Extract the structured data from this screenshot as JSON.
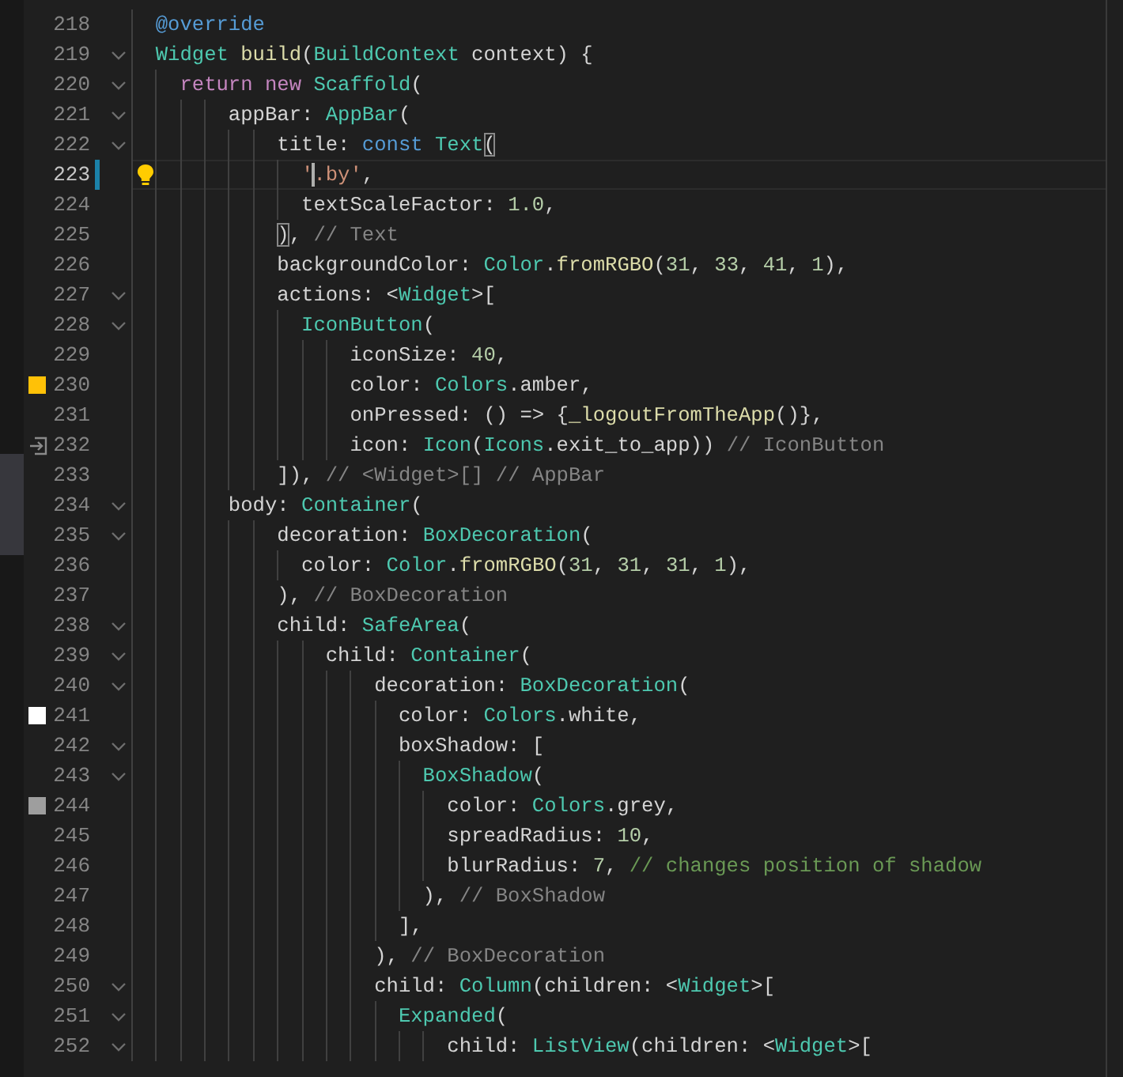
{
  "editor": {
    "lines": [
      {
        "number": "218",
        "foldable": false,
        "current": false,
        "tokens": [
          {
            "kind": "dec",
            "text": "  @override"
          }
        ]
      },
      {
        "number": "219",
        "foldable": true,
        "current": false,
        "tokens": [
          {
            "kind": "type",
            "text": "  Widget "
          },
          {
            "kind": "fn",
            "text": "build"
          },
          {
            "kind": "plain",
            "text": "("
          },
          {
            "kind": "type",
            "text": "BuildContext"
          },
          {
            "kind": "plain",
            "text": " context) {"
          }
        ]
      },
      {
        "number": "220",
        "foldable": true,
        "current": false,
        "tokens": [
          {
            "kind": "ctl",
            "text": "    return new "
          },
          {
            "kind": "type",
            "text": "Scaffold"
          },
          {
            "kind": "plain",
            "text": "("
          }
        ]
      },
      {
        "number": "221",
        "foldable": true,
        "current": false,
        "tokens": [
          {
            "kind": "plain",
            "text": "        appBar: "
          },
          {
            "kind": "type",
            "text": "AppBar"
          },
          {
            "kind": "plain",
            "text": "("
          }
        ]
      },
      {
        "number": "222",
        "foldable": true,
        "current": false,
        "tokens": [
          {
            "kind": "plain",
            "text": "            title: "
          },
          {
            "kind": "kw",
            "text": "const "
          },
          {
            "kind": "type",
            "text": "Text"
          },
          {
            "kind": "bracket",
            "text": "("
          }
        ]
      },
      {
        "number": "223",
        "foldable": false,
        "current": true,
        "modified": true,
        "lightbulb": true,
        "tokens": [
          {
            "kind": "str",
            "text": "              '"
          },
          {
            "kind": "cursor"
          },
          {
            "kind": "str",
            "text": ".by'"
          },
          {
            "kind": "plain",
            "text": ","
          }
        ]
      },
      {
        "number": "224",
        "foldable": false,
        "current": false,
        "tokens": [
          {
            "kind": "plain",
            "text": "              textScaleFactor: "
          },
          {
            "kind": "num",
            "text": "1.0"
          },
          {
            "kind": "plain",
            "text": ","
          }
        ]
      },
      {
        "number": "225",
        "foldable": false,
        "current": false,
        "tokens": [
          {
            "kind": "bracket",
            "text": "            )"
          },
          {
            "kind": "plain",
            "text": ", "
          },
          {
            "kind": "label",
            "text": "// Text"
          }
        ]
      },
      {
        "number": "226",
        "foldable": false,
        "current": false,
        "tokens": [
          {
            "kind": "plain",
            "text": "            backgroundColor: "
          },
          {
            "kind": "type",
            "text": "Color"
          },
          {
            "kind": "plain",
            "text": "."
          },
          {
            "kind": "fn",
            "text": "fromRGBO"
          },
          {
            "kind": "plain",
            "text": "("
          },
          {
            "kind": "num",
            "text": "31"
          },
          {
            "kind": "plain",
            "text": ", "
          },
          {
            "kind": "num",
            "text": "33"
          },
          {
            "kind": "plain",
            "text": ", "
          },
          {
            "kind": "num",
            "text": "41"
          },
          {
            "kind": "plain",
            "text": ", "
          },
          {
            "kind": "num",
            "text": "1"
          },
          {
            "kind": "plain",
            "text": "),"
          }
        ]
      },
      {
        "number": "227",
        "foldable": true,
        "current": false,
        "tokens": [
          {
            "kind": "plain",
            "text": "            actions: <"
          },
          {
            "kind": "type",
            "text": "Widget"
          },
          {
            "kind": "plain",
            "text": ">["
          }
        ]
      },
      {
        "number": "228",
        "foldable": true,
        "current": false,
        "tokens": [
          {
            "kind": "type",
            "text": "              IconButton"
          },
          {
            "kind": "plain",
            "text": "("
          }
        ]
      },
      {
        "number": "229",
        "foldable": false,
        "current": false,
        "tokens": [
          {
            "kind": "plain",
            "text": "                  iconSize: "
          },
          {
            "kind": "num",
            "text": "40"
          },
          {
            "kind": "plain",
            "text": ","
          }
        ]
      },
      {
        "number": "230",
        "foldable": false,
        "current": false,
        "color": "#ffc107",
        "tokens": [
          {
            "kind": "plain",
            "text": "                  color: "
          },
          {
            "kind": "type",
            "text": "Colors"
          },
          {
            "kind": "plain",
            "text": ".amber,"
          }
        ]
      },
      {
        "number": "231",
        "foldable": false,
        "current": false,
        "tokens": [
          {
            "kind": "plain",
            "text": "                  onPressed: () => {"
          },
          {
            "kind": "fn",
            "text": "_logoutFromTheApp"
          },
          {
            "kind": "plain",
            "text": "()},"
          }
        ]
      },
      {
        "number": "232",
        "foldable": false,
        "current": false,
        "gutter_icon": true,
        "tokens": [
          {
            "kind": "plain",
            "text": "                  icon: "
          },
          {
            "kind": "type",
            "text": "Icon"
          },
          {
            "kind": "plain",
            "text": "("
          },
          {
            "kind": "type",
            "text": "Icons"
          },
          {
            "kind": "plain",
            "text": ".exit_to_app)) "
          },
          {
            "kind": "label",
            "text": "// IconButton"
          }
        ]
      },
      {
        "number": "233",
        "foldable": false,
        "current": false,
        "tokens": [
          {
            "kind": "plain",
            "text": "            ]), "
          },
          {
            "kind": "label",
            "text": "// <Widget>[] // AppBar"
          }
        ]
      },
      {
        "number": "234",
        "foldable": true,
        "current": false,
        "tokens": [
          {
            "kind": "plain",
            "text": "        body: "
          },
          {
            "kind": "type",
            "text": "Container"
          },
          {
            "kind": "plain",
            "text": "("
          }
        ]
      },
      {
        "number": "235",
        "foldable": true,
        "current": false,
        "tokens": [
          {
            "kind": "plain",
            "text": "            decoration: "
          },
          {
            "kind": "type",
            "text": "BoxDecoration"
          },
          {
            "kind": "plain",
            "text": "("
          }
        ]
      },
      {
        "number": "236",
        "foldable": false,
        "current": false,
        "tokens": [
          {
            "kind": "plain",
            "text": "              color: "
          },
          {
            "kind": "type",
            "text": "Color"
          },
          {
            "kind": "plain",
            "text": "."
          },
          {
            "kind": "fn",
            "text": "fromRGBO"
          },
          {
            "kind": "plain",
            "text": "("
          },
          {
            "kind": "num",
            "text": "31"
          },
          {
            "kind": "plain",
            "text": ", "
          },
          {
            "kind": "num",
            "text": "31"
          },
          {
            "kind": "plain",
            "text": ", "
          },
          {
            "kind": "num",
            "text": "31"
          },
          {
            "kind": "plain",
            "text": ", "
          },
          {
            "kind": "num",
            "text": "1"
          },
          {
            "kind": "plain",
            "text": "),"
          }
        ]
      },
      {
        "number": "237",
        "foldable": false,
        "current": false,
        "tokens": [
          {
            "kind": "plain",
            "text": "            ), "
          },
          {
            "kind": "label",
            "text": "// BoxDecoration"
          }
        ]
      },
      {
        "number": "238",
        "foldable": true,
        "current": false,
        "tokens": [
          {
            "kind": "plain",
            "text": "            child: "
          },
          {
            "kind": "type",
            "text": "SafeArea"
          },
          {
            "kind": "plain",
            "text": "("
          }
        ]
      },
      {
        "number": "239",
        "foldable": true,
        "current": false,
        "tokens": [
          {
            "kind": "plain",
            "text": "                child: "
          },
          {
            "kind": "type",
            "text": "Container"
          },
          {
            "kind": "plain",
            "text": "("
          }
        ]
      },
      {
        "number": "240",
        "foldable": true,
        "current": false,
        "tokens": [
          {
            "kind": "plain",
            "text": "                    decoration: "
          },
          {
            "kind": "type",
            "text": "BoxDecoration"
          },
          {
            "kind": "plain",
            "text": "("
          }
        ]
      },
      {
        "number": "241",
        "foldable": false,
        "current": false,
        "color": "#ffffff",
        "tokens": [
          {
            "kind": "plain",
            "text": "                      color: "
          },
          {
            "kind": "type",
            "text": "Colors"
          },
          {
            "kind": "plain",
            "text": ".white,"
          }
        ]
      },
      {
        "number": "242",
        "foldable": true,
        "current": false,
        "tokens": [
          {
            "kind": "plain",
            "text": "                      boxShadow: ["
          }
        ]
      },
      {
        "number": "243",
        "foldable": true,
        "current": false,
        "tokens": [
          {
            "kind": "type",
            "text": "                        BoxShadow"
          },
          {
            "kind": "plain",
            "text": "("
          }
        ]
      },
      {
        "number": "244",
        "foldable": false,
        "current": false,
        "color": "#9e9e9e",
        "tokens": [
          {
            "kind": "plain",
            "text": "                          color: "
          },
          {
            "kind": "type",
            "text": "Colors"
          },
          {
            "kind": "plain",
            "text": ".grey,"
          }
        ]
      },
      {
        "number": "245",
        "foldable": false,
        "current": false,
        "tokens": [
          {
            "kind": "plain",
            "text": "                          spreadRadius: "
          },
          {
            "kind": "num",
            "text": "10"
          },
          {
            "kind": "plain",
            "text": ","
          }
        ]
      },
      {
        "number": "246",
        "foldable": false,
        "current": false,
        "tokens": [
          {
            "kind": "plain",
            "text": "                          blurRadius: "
          },
          {
            "kind": "num",
            "text": "7"
          },
          {
            "kind": "plain",
            "text": ", "
          },
          {
            "kind": "cmt",
            "text": "// changes position of shadow"
          }
        ]
      },
      {
        "number": "247",
        "foldable": false,
        "current": false,
        "tokens": [
          {
            "kind": "plain",
            "text": "                        ), "
          },
          {
            "kind": "label",
            "text": "// BoxShadow"
          }
        ]
      },
      {
        "number": "248",
        "foldable": false,
        "current": false,
        "tokens": [
          {
            "kind": "plain",
            "text": "                      ],"
          }
        ]
      },
      {
        "number": "249",
        "foldable": false,
        "current": false,
        "tokens": [
          {
            "kind": "plain",
            "text": "                    ), "
          },
          {
            "kind": "label",
            "text": "// BoxDecoration"
          }
        ]
      },
      {
        "number": "250",
        "foldable": true,
        "current": false,
        "tokens": [
          {
            "kind": "plain",
            "text": "                    child: "
          },
          {
            "kind": "type",
            "text": "Column"
          },
          {
            "kind": "plain",
            "text": "(children: <"
          },
          {
            "kind": "type",
            "text": "Widget"
          },
          {
            "kind": "plain",
            "text": ">["
          }
        ]
      },
      {
        "number": "251",
        "foldable": true,
        "current": false,
        "tokens": [
          {
            "kind": "type",
            "text": "                      Expanded"
          },
          {
            "kind": "plain",
            "text": "("
          }
        ]
      },
      {
        "number": "252",
        "foldable": true,
        "current": false,
        "tokens": [
          {
            "kind": "plain",
            "text": "                          child: "
          },
          {
            "kind": "type",
            "text": "ListView"
          },
          {
            "kind": "plain",
            "text": "(children: <"
          },
          {
            "kind": "type",
            "text": "Widget"
          },
          {
            "kind": "plain",
            "text": ">["
          }
        ]
      }
    ]
  }
}
